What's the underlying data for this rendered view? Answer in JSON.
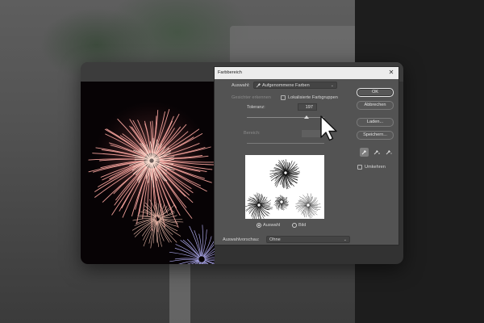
{
  "dialog": {
    "title": "Farbbereich",
    "close_glyph": "✕",
    "selection": {
      "label": "Auswahl:",
      "icon": "eyedropper-icon",
      "value": "Aufgenommene Farben"
    },
    "detect_faces": {
      "label": "Gesichter erkennen",
      "checked": false,
      "enabled": false
    },
    "localized_clusters": {
      "label": "Lokalisierte Farbgruppen",
      "checked": false
    },
    "tolerance": {
      "label": "Toleranz:",
      "value": "197",
      "fraction": 0.77
    },
    "range": {
      "label": "Bereich:",
      "value": "",
      "enabled": false
    },
    "preview_mode": {
      "options": [
        {
          "label": "Auswahl",
          "selected": true
        },
        {
          "label": "Bild",
          "selected": false
        }
      ]
    },
    "selection_preview": {
      "label": "Auswahlvorschau:",
      "value": "Ohne"
    },
    "buttons": {
      "ok": "OK",
      "cancel": "Abbrechen",
      "load": "Laden...",
      "save": "Speichern..."
    },
    "eyedroppers": [
      {
        "name": "eyedropper-icon",
        "active": true
      },
      {
        "name": "eyedropper-plus-icon",
        "active": false
      },
      {
        "name": "eyedropper-minus-icon",
        "active": false
      }
    ],
    "invert": {
      "label": "Umkehren",
      "checked": false
    }
  },
  "colors": {
    "dialog_bg": "#535353",
    "titlebar_bg": "#ececec",
    "firework_red": "#e8888a",
    "firework_blue": "#a9a6e8"
  }
}
